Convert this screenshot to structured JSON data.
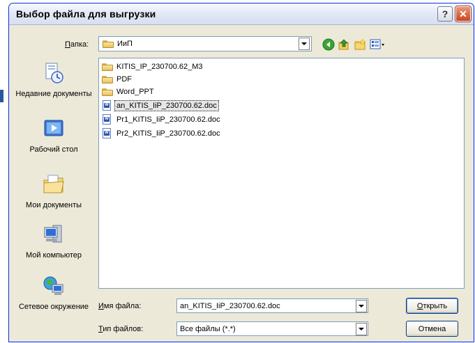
{
  "window": {
    "title": "Выбор файла для выгрузки"
  },
  "title_buttons": {
    "help": "?",
    "close": "✕"
  },
  "lookin": {
    "label_hotkey": "П",
    "label_rest": "апка:",
    "value": "ИиП"
  },
  "toolbar": {
    "icons": [
      "back-icon",
      "up-folder-icon",
      "new-folder-icon",
      "views-menu-icon"
    ]
  },
  "places": [
    {
      "label": "Недавние документы",
      "icon": "recent-documents-icon"
    },
    {
      "label": "Рабочий стол",
      "icon": "desktop-icon"
    },
    {
      "label": "Мои документы",
      "icon": "my-documents-icon"
    },
    {
      "label": "Мой компьютер",
      "icon": "my-computer-icon"
    },
    {
      "label": "Сетевое окружение",
      "icon": "network-places-icon"
    }
  ],
  "files": [
    {
      "name": "KITIS_IP_230700.62_M3",
      "type": "folder"
    },
    {
      "name": "PDF",
      "type": "folder"
    },
    {
      "name": "Word_PPT",
      "type": "folder"
    },
    {
      "name": "an_KITIS_IiP_230700.62.doc",
      "type": "doc",
      "selected": true
    },
    {
      "name": "Pr1_KITIS_IiP_230700.62.doc",
      "type": "doc"
    },
    {
      "name": "Pr2_KITIS_IiP_230700.62.doc",
      "type": "doc"
    }
  ],
  "filename": {
    "label_hotkey": "И",
    "label_rest": "мя файла:",
    "value": "an_KITIS_IiP_230700.62.doc"
  },
  "filetype": {
    "label_hotkey": "Т",
    "label_rest": "ип файлов:",
    "value": "Все файлы (*.*)"
  },
  "buttons": {
    "open_hotkey": "О",
    "open_rest": "ткрыть",
    "cancel": "Отмена"
  },
  "colors": {
    "title_bar": "#e4e9f6",
    "dialog_bg": "#ece9d8",
    "close_button": "#c8451f",
    "field_border": "#7f9db9"
  }
}
